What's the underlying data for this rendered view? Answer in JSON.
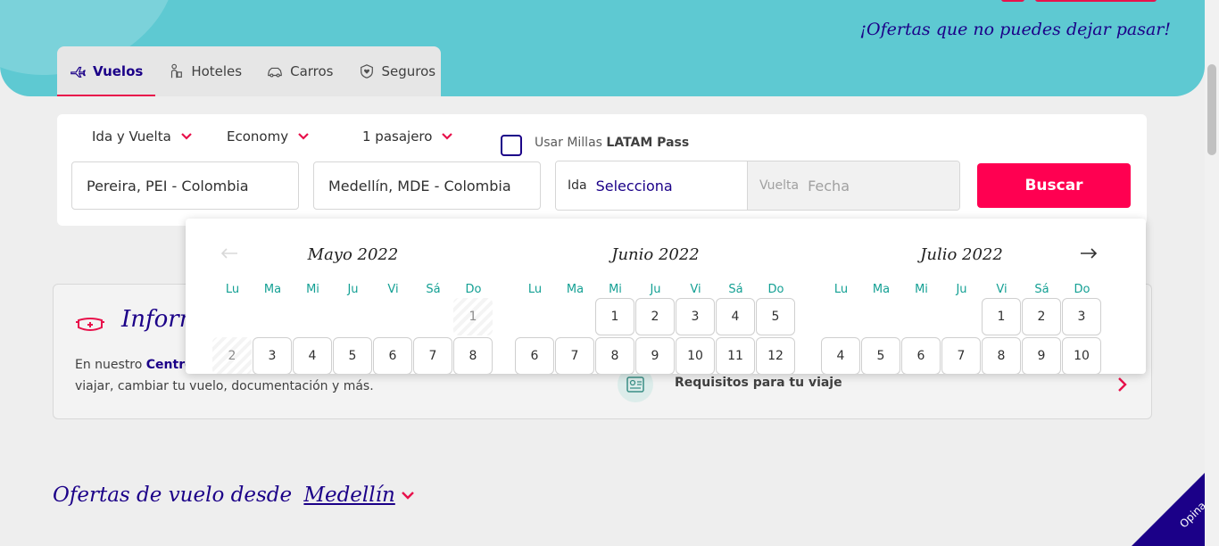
{
  "hero": {
    "tagline": "¡Ofertas que no puedes dejar pasar!"
  },
  "tabs": [
    {
      "label": "Vuelos",
      "icon": "plane-icon",
      "active": true
    },
    {
      "label": "Hoteles",
      "icon": "person-luggage-icon",
      "active": false
    },
    {
      "label": "Carros",
      "icon": "car-icon",
      "active": false
    },
    {
      "label": "Seguros",
      "icon": "shield-heart-icon",
      "active": false
    }
  ],
  "search": {
    "trip_type": "Ida y Vuelta",
    "cabin": "Economy",
    "passengers": "1 pasajero",
    "miles_prefix": "Usar Millas ",
    "miles_brand": "LATAM Pass",
    "origin": "Pereira, PEI - Colombia",
    "destination": "Medellín, MDE - Colombia",
    "departure_label": "Ida",
    "departure_value": "Selecciona",
    "return_label": "Vuelta",
    "return_value": "Fecha",
    "button": "Buscar"
  },
  "calendar": {
    "weekdays": [
      "Lu",
      "Ma",
      "Mi",
      "Ju",
      "Vi",
      "Sá",
      "Do"
    ],
    "months": [
      {
        "title": "Mayo 2022",
        "rows": [
          [
            null,
            null,
            null,
            null,
            null,
            null,
            "1"
          ],
          [
            "2",
            "3",
            "4",
            "5",
            "6",
            "7",
            "8"
          ]
        ],
        "disabled_days": [
          "1",
          "2"
        ]
      },
      {
        "title": "Junio 2022",
        "rows": [
          [
            null,
            null,
            "1",
            "2",
            "3",
            "4",
            "5"
          ],
          [
            "6",
            "7",
            "8",
            "9",
            "10",
            "11",
            "12"
          ]
        ],
        "disabled_days": []
      },
      {
        "title": "Julio 2022",
        "rows": [
          [
            null,
            null,
            null,
            null,
            "1",
            "2",
            "3"
          ],
          [
            "4",
            "5",
            "6",
            "7",
            "8",
            "9",
            "10"
          ]
        ],
        "disabled_days": []
      }
    ]
  },
  "info": {
    "title": "Inform",
    "text_prefix": "En nuestro ",
    "text_link": "Centro",
    "text_line2": "viajar, cambiar tu vuelo, documentación y más.",
    "requirements_label": "Requisitos para tu viaje"
  },
  "offers": {
    "prefix": "Ofertas de vuelo desde ",
    "city": "Medellín"
  },
  "feedback": {
    "label": "Opina"
  },
  "colors": {
    "brand_blue": "#1b0088",
    "accent_red": "#ff0051",
    "teal": "#5ec9d2",
    "weekday_teal": "#14a094"
  }
}
